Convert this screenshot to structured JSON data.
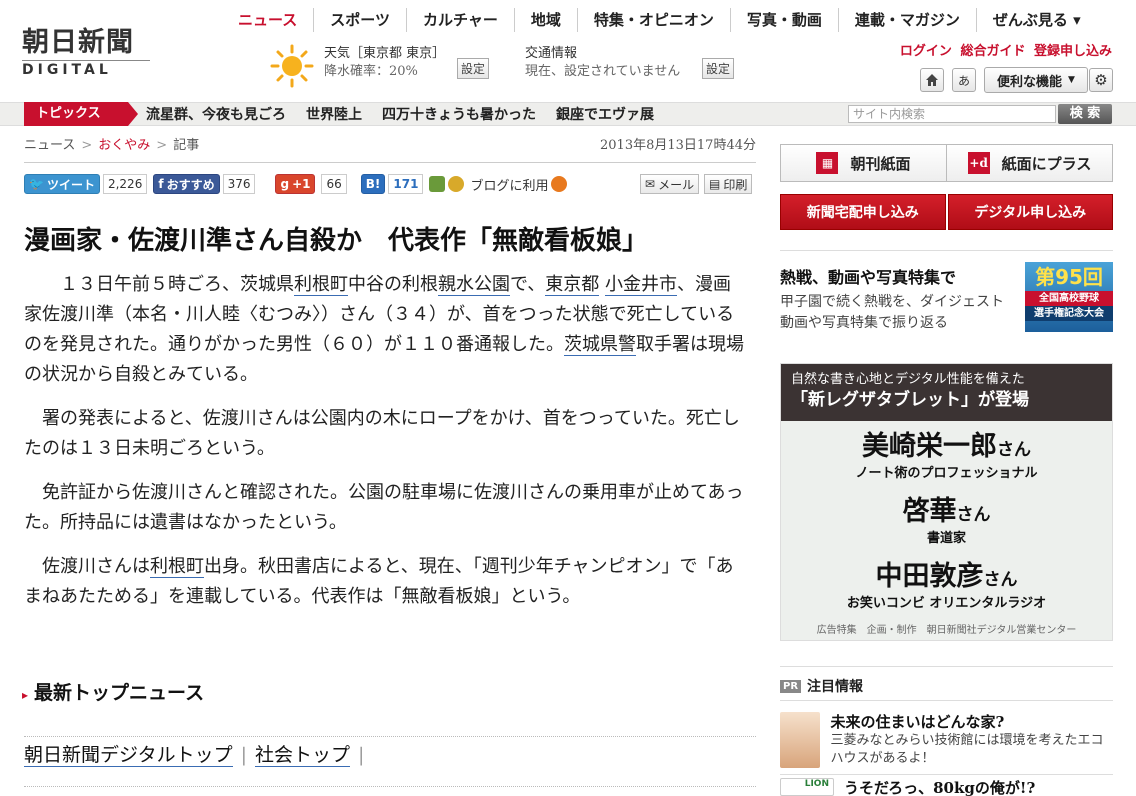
{
  "logo": {
    "jp": "朝日新聞",
    "en": "DIGITAL"
  },
  "nav": [
    "ニュース",
    "スポーツ",
    "カルチャー",
    "地域",
    "特集・オピニオン",
    "写真・動画",
    "連載・マガジン",
    "ぜんぶ見る ▾"
  ],
  "weather": {
    "label": "天気［東京都 東京］",
    "rain": "降水確率：20%",
    "set": "設定"
  },
  "traffic": {
    "label": "交通情報",
    "status": "現在、設定されていません",
    "set": "設定"
  },
  "toplinks": {
    "login": "ログイン",
    "guide": "総合ガイド",
    "register": "登録申し込み"
  },
  "tools": {
    "home_icon": "home-icon",
    "text_size": "あ",
    "convenient": "便利な機能",
    "settings_icon": "gear-icon"
  },
  "topics": {
    "label": "トピックス",
    "items": [
      "流星群、今夜も見ごろ",
      "世界陸上",
      "四万十きょうも暑かった",
      "銀座でエヴァ展"
    ]
  },
  "search": {
    "placeholder": "サイト内検索",
    "button": "検 索"
  },
  "breadcrumb": {
    "news": "ニュース",
    "okuyami": "おくやみ",
    "article": "記事",
    "sep": ">"
  },
  "date": "2013年8月13日17時44分",
  "social": {
    "tweet": "ツイート",
    "tweet_count": "2,226",
    "fb": "おすすめ",
    "fb_count": "376",
    "gplus": "+1",
    "gplus_count": "66",
    "hatena": "B!",
    "hatena_count": "171",
    "blog": "ブログに利用",
    "mail": "メール",
    "print": "印刷"
  },
  "article": {
    "headline": "漫画家・佐渡川準さん自殺か　代表作「無敵看板娘」",
    "p1": {
      "a": "１３日午前５時ごろ、茨城県",
      "l1": "利根町",
      "b": "中谷の利根",
      "l2": "親水公園",
      "c": "で、",
      "l3": "東京都",
      "d": " ",
      "l4": "小金井市",
      "e": "、漫画家佐渡川準（本名・川人睦〈むつみ〉）さん（３４）が、首をつった状態で死亡しているのを発見された。通りがかった男性（６０）が１１０番通報した。",
      "l5": "茨城県警",
      "f": "取手署は現場の状況から自殺とみている。"
    },
    "p2": "署の発表によると、佐渡川さんは公園内の木にロープをかけ、首をつっていた。死亡したのは１３日未明ごろという。",
    "p3": "免許証から佐渡川さんと確認された。公園の駐車場に佐渡川さんの乗用車が止めてあった。所持品には遺書はなかったという。",
    "p4": {
      "a": "佐渡川さんは",
      "l1": "利根町",
      "b": "出身。秋田書店によると、現在、「週刊少年チャンピオン」で「あまねあたためる」を連載している。代表作は「無敵看板娘」という。"
    }
  },
  "latest_news": "最新トップニュース",
  "footer_links": [
    "朝日新聞デジタルトップ",
    "社会トップ"
  ],
  "right": {
    "morning_paper": "朝刊紙面",
    "paper_plus": "紙面にプラス",
    "home_delivery": "新聞宅配申し込み",
    "digital_apply": "デジタル申し込み",
    "promo_title": "熱戦、動画や写真特集で",
    "promo_text": "甲子園で続く熱戦を、ダイジェスト動画や写真特集で振り返る",
    "promo_img": {
      "num": "第95回",
      "l1": "全国高校野球",
      "l2": "選手権記念大会"
    },
    "ad": {
      "line1": "自然な書き心地とデジタル性能を備えた",
      "line2": "「新レグザタブレット」が登場",
      "people": [
        {
          "name": "美崎栄一郎",
          "suffix": "さん",
          "role": "ノート術のプロフェッショナル"
        },
        {
          "name": "啓華",
          "suffix": "さん",
          "role": "書道家"
        },
        {
          "name": "中田敦彦",
          "suffix": "さん",
          "role": "お笑いコンビ オリエンタルラジオ"
        }
      ],
      "footer": "広告特集　企画・制作　朝日新聞社デジタル営業センター"
    },
    "pr": {
      "badge": "PR",
      "title": "注目情報",
      "items": [
        {
          "title": "未来の住まいはどんな家?",
          "desc": "三菱みなとみらい技術館には環境を考えたエコハウスがあるよ！"
        },
        {
          "title": "うそだろっ、80kgの俺が!?",
          "desc": ""
        }
      ]
    }
  }
}
